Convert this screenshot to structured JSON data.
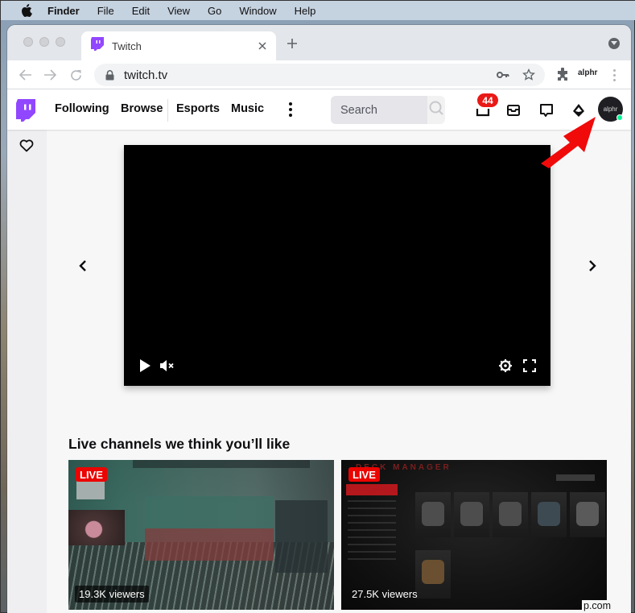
{
  "menubar": {
    "icon": "apple-icon",
    "items": [
      "Finder",
      "File",
      "Edit",
      "View",
      "Go",
      "Window",
      "Help"
    ]
  },
  "browser": {
    "tab": {
      "title": "Twitch",
      "favicon": "twitch-icon"
    },
    "url": "twitch.tv",
    "profile_label": "alphr",
    "icons": [
      "back-icon",
      "forward-icon",
      "reload-icon",
      "lock-icon",
      "key-icon",
      "star-icon",
      "extensions-icon",
      "kebab-menu-icon",
      "new-tab-icon",
      "tab-search-icon"
    ]
  },
  "twitch_nav": {
    "links": [
      "Following",
      "Browse",
      "Esports",
      "Music"
    ],
    "search_placeholder": "Search",
    "notifications_count": "44",
    "avatar_text": "alphr",
    "status_color": "#00f593",
    "brand_color": "#9146ff"
  },
  "sidebar": {
    "icon": "heart-icon"
  },
  "player": {
    "controls": [
      "play-icon",
      "mute-icon",
      "settings-icon",
      "fullscreen-icon"
    ]
  },
  "section": {
    "title": "Live channels we think you’ll like",
    "channels": [
      {
        "live_label": "LIVE",
        "viewers": "19.3K viewers"
      },
      {
        "live_label": "LIVE",
        "viewers": "27.5K viewers",
        "overlay_title": "DECK MANAGER"
      }
    ]
  },
  "watermark": "p.com"
}
